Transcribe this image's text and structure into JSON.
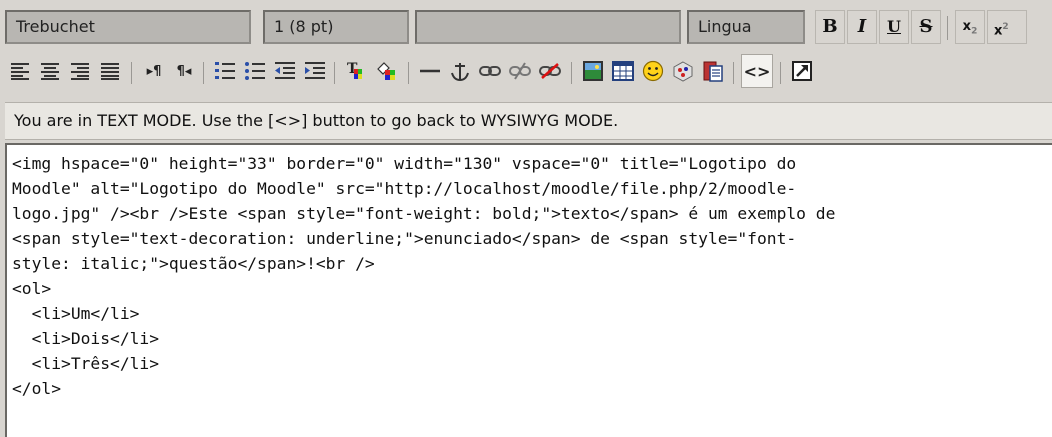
{
  "toolbar": {
    "font_name": "Trebuchet",
    "font_size": "1 (8 pt)",
    "format_block": "",
    "language": "Lingua",
    "bold_label": "B",
    "italic_label": "I",
    "underline_label": "U",
    "strike_label": "S",
    "subscript_label": "x",
    "subscript_suffix": "2",
    "superscript_label": "x",
    "superscript_suffix": "2",
    "ltr_label": "▸¶",
    "rtl_label": "¶◂",
    "html_mode_label": "<>"
  },
  "icons": [
    "align-left-icon",
    "align-center-icon",
    "align-right-icon",
    "justify-icon",
    "ltr-icon",
    "rtl-icon",
    "ordered-list-icon",
    "unordered-list-icon",
    "outdent-icon",
    "indent-icon",
    "text-color-icon",
    "background-color-icon",
    "horizontal-rule-icon",
    "anchor-icon",
    "link-icon",
    "unlink-icon",
    "nolink-icon",
    "insert-image-icon",
    "insert-table-icon",
    "smiley-icon",
    "special-char-icon",
    "paste-word-icon",
    "html-mode-icon",
    "fullscreen-icon"
  ],
  "status": {
    "message": "You are in TEXT MODE. Use the [<>] button to go back to WYSIWYG MODE."
  },
  "source": {
    "text": "<img hspace=\"0\" height=\"33\" border=\"0\" width=\"130\" vspace=\"0\" title=\"Logotipo do\nMoodle\" alt=\"Logotipo do Moodle\" src=\"http://localhost/moodle/file.php/2/moodle-\nlogo.jpg\" /><br />Este <span style=\"font-weight: bold;\">texto</span> é um exemplo de\n<span style=\"text-decoration: underline;\">enunciado</span> de <span style=\"font-\nstyle: italic;\">questão</span>!<br />\n<ol>\n  <li>Um</li>\n  <li>Dois</li>\n  <li>Três</li>\n</ol>"
  }
}
